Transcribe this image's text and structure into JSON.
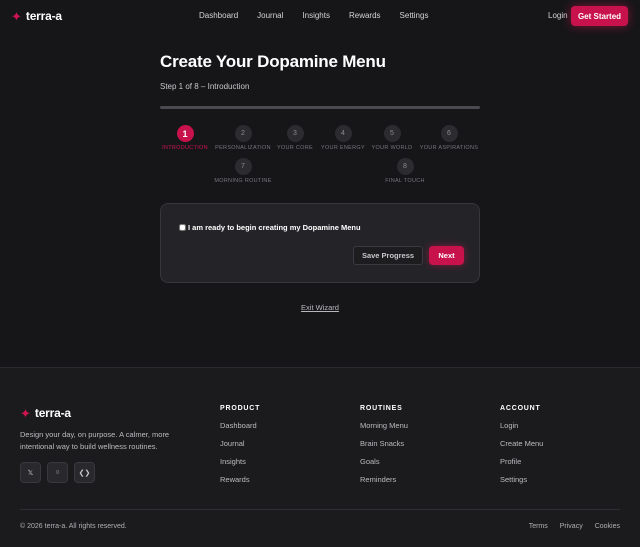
{
  "nav": {
    "brand_icon": "sparkle-icon",
    "brand": "terra-a",
    "links": [
      "Dashboard",
      "Journal",
      "Insights",
      "Rewards",
      "Settings"
    ],
    "login": "Login",
    "cta": "Get Started"
  },
  "wizard": {
    "title": "Create Your Dopamine Menu",
    "step_text": "Step 1 of 8 – Introduction",
    "progress": 0.0,
    "steps": [
      {
        "num": "1",
        "label": "INTRODUCTION",
        "active": true
      },
      {
        "num": "2",
        "label": "PERSONALIZATION",
        "active": false
      },
      {
        "num": "3",
        "label": "YOUR CORE",
        "active": false
      },
      {
        "num": "4",
        "label": "YOUR ENERGY",
        "active": false
      },
      {
        "num": "5",
        "label": "YOUR WORLD",
        "active": false
      },
      {
        "num": "6",
        "label": "YOUR ASPIRATIONS",
        "active": false
      },
      {
        "num": "7",
        "label": "MORNING ROUTINE",
        "active": false
      },
      {
        "num": "8",
        "label": "FINAL TOUCH",
        "active": false
      }
    ],
    "checkbox_label": "I am ready to begin creating my Dopamine Menu",
    "checkbox_checked": false,
    "save_label": "Save Progress",
    "next_label": "Next",
    "exit_label": "Exit Wizard"
  },
  "footer": {
    "brand": "terra-a",
    "tagline": "Design your day, on purpose. A calmer, more intentional way to build wellness routines.",
    "socials": [
      {
        "icon": "x-icon",
        "glyph": "𝕏"
      },
      {
        "icon": "github-icon",
        "glyph": "○"
      },
      {
        "icon": "code-icon",
        "glyph": "❮❯"
      }
    ],
    "columns": [
      {
        "title": "PRODUCT",
        "links": [
          "Dashboard",
          "Journal",
          "Insights",
          "Rewards"
        ]
      },
      {
        "title": "ROUTINES",
        "links": [
          "Morning Menu",
          "Brain Snacks",
          "Goals",
          "Reminders"
        ]
      },
      {
        "title": "ACCOUNT",
        "links": [
          "Login",
          "Create Menu",
          "Profile",
          "Settings"
        ]
      }
    ],
    "copyright": "© 2026 terra-a. All rights reserved.",
    "legal": [
      "Terms",
      "Privacy",
      "Cookies"
    ]
  },
  "colors": {
    "accent": "#c8124b",
    "background": "#161618",
    "card": "#242428",
    "footer": "#1b1b1d"
  }
}
